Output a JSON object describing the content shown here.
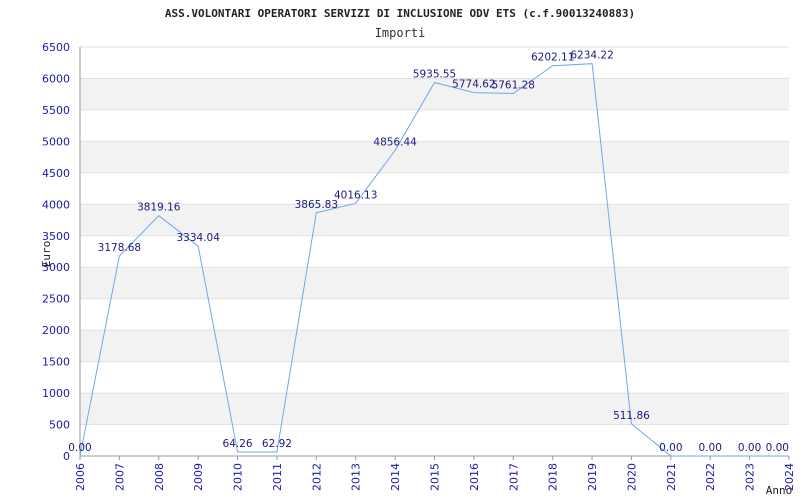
{
  "chart_data": {
    "type": "line",
    "title": "ASS.VOLONTARI OPERATORI SERVIZI DI INCLUSIONE ODV ETS (c.f.90013240883)",
    "subtitle": "Importi",
    "xlabel": "Anno",
    "ylabel": "Euro",
    "ylim": [
      0,
      6500
    ],
    "yticks": [
      0,
      500,
      1000,
      1500,
      2000,
      2500,
      3000,
      3500,
      4000,
      4500,
      5000,
      5500,
      6000,
      6500
    ],
    "grid": "horizontal alternating bands",
    "categories": [
      "2006",
      "2007",
      "2008",
      "2009",
      "2010",
      "2011",
      "2012",
      "2013",
      "2014",
      "2015",
      "2016",
      "2017",
      "2018",
      "2019",
      "2020",
      "2021",
      "2022",
      "2023",
      "2024"
    ],
    "series": [
      {
        "values": [
          0,
          3178.68,
          3819.16,
          3334.04,
          64.26,
          62.92,
          3865.83,
          4016.13,
          4856.44,
          5935.55,
          5774.62,
          5761.28,
          6202.11,
          6234.22,
          511.86,
          0,
          0,
          0,
          0
        ],
        "labels": [
          "0.00",
          "3178.68",
          "3819.16",
          "3334.04",
          "64.26",
          "62.92",
          "3865.83",
          "4016.13",
          "4856.44",
          "5935.55",
          "5774.62",
          "5761.28",
          "6202.11",
          "6234.22",
          "511.86",
          "0.00",
          "0.00",
          "0.00",
          "0.00"
        ]
      }
    ],
    "colors": {
      "line": "#6fa8ea",
      "band": "#f2f2f2",
      "tick_text": "#1a1aa6",
      "label_text": "#1a1a80"
    }
  }
}
